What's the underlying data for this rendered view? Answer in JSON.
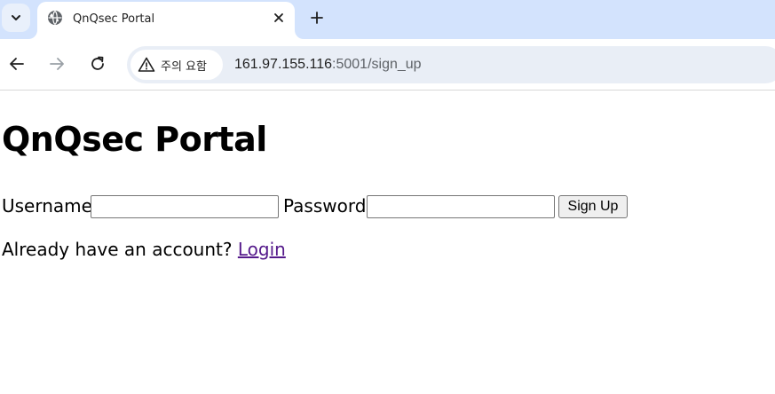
{
  "browser": {
    "tab": {
      "title": "QnQsec Portal",
      "favicon": "globe-icon"
    },
    "toolbar": {
      "security_label": "주의 요함",
      "url_host": "161.97.155.116",
      "url_rest": ":5001/sign_up"
    },
    "colors": {
      "tabstrip_bg": "#d3e3fd",
      "omnibox_bg": "#e9eef6",
      "visited_link": "#551a8b"
    }
  },
  "page": {
    "title": "QnQsec Portal",
    "form": {
      "username_label": "Username",
      "username_value": "",
      "password_label": "Password",
      "password_value": "",
      "submit_label": "Sign Up"
    },
    "footer": {
      "prompt": "Already have an account?",
      "link_label": "Login"
    }
  }
}
